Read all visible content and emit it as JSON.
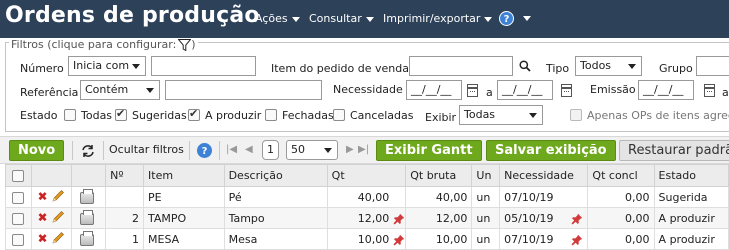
{
  "header": {
    "title": "Ordens de produção",
    "menus": [
      "Ações",
      "Consultar",
      "Imprimir/exportar"
    ],
    "help_icon_text": "?"
  },
  "filters": {
    "legend": "Filtros (clique para configurar:",
    "numero": {
      "label": "Número",
      "operator": "Inicia com",
      "value": ""
    },
    "item_pedido": {
      "label": "Item do pedido de venda",
      "value": ""
    },
    "tipo": {
      "label": "Tipo",
      "value": "Todos"
    },
    "grupo": {
      "label": "Grupo",
      "value": ""
    },
    "referencia": {
      "label": "Referência",
      "operator": "Contém",
      "value": ""
    },
    "necessidade": {
      "label": "Necessidade",
      "from": "__/__/__",
      "sep": "a",
      "to": "__/__/__"
    },
    "emissao": {
      "label": "Emissão",
      "from": "__/__/__",
      "sep": "a",
      "to": "__/__/__"
    },
    "estado": {
      "label": "Estado",
      "options": [
        {
          "label": "Todas",
          "checked": false
        },
        {
          "label": "Sugeridas",
          "checked": true
        },
        {
          "label": "A produzir",
          "checked": true
        },
        {
          "label": "Fechadas",
          "checked": false
        },
        {
          "label": "Canceladas",
          "checked": false
        }
      ]
    },
    "exibir": {
      "label": "Exibir",
      "value": "Todas"
    },
    "apenas_ops": {
      "label": "Apenas OPs de itens agreg",
      "checked": false
    }
  },
  "toolbar": {
    "new_label": "Novo",
    "hide_filters_label": "Ocultar filtros",
    "help_text": "?",
    "page": "1",
    "page_size": "50",
    "gantt_label": "Exibir Gantt",
    "save_view_label": "Salvar exibição",
    "restore_label": "Restaurar padrã"
  },
  "table": {
    "columns": [
      "Nº",
      "Item",
      "Descrição",
      "Qt",
      "Qt bruta",
      "Un",
      "Necessidade",
      "Qt concl",
      "Estado"
    ],
    "rows": [
      {
        "n": "",
        "item": "PE",
        "descricao": "Pé",
        "qt": "40,00",
        "qt_pin": false,
        "qt_bruta": "40,00",
        "un": "un",
        "necessidade": "07/10/19",
        "nec_pin": false,
        "qt_concl": "0,00",
        "estado": "Sugerida"
      },
      {
        "n": "2",
        "item": "TAMPO",
        "descricao": "Tampo",
        "qt": "12,00",
        "qt_pin": true,
        "qt_bruta": "12,00",
        "un": "un",
        "necessidade": "05/10/19",
        "nec_pin": true,
        "qt_concl": "0,00",
        "estado": "A produzir"
      },
      {
        "n": "1",
        "item": "MESA",
        "descricao": "Mesa",
        "qt": "10,00",
        "qt_pin": true,
        "qt_bruta": "10,00",
        "un": "un",
        "necessidade": "07/10/19",
        "nec_pin": true,
        "qt_concl": "0,00",
        "estado": "A produzir"
      }
    ]
  },
  "colors": {
    "header_bg": "#2d4159",
    "green_button": "#6ea81c",
    "pin_red": "#d23b3b",
    "delete_red": "#cc2222",
    "edit_orange": "#e69a1e"
  }
}
